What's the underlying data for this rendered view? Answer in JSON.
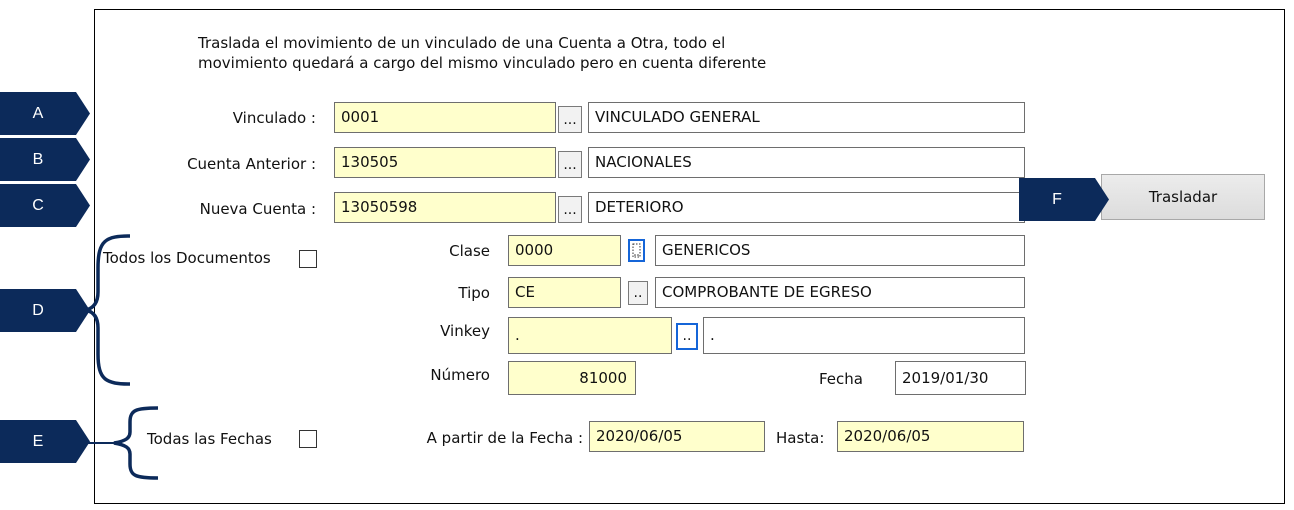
{
  "intro": {
    "text": "Traslada el movimiento de un vinculado de una Cuenta a Otra, todo el\nmovimiento quedará a cargo del mismo vinculado pero en cuenta diferente"
  },
  "vinculado": {
    "label": "Vinculado :",
    "code": "0001",
    "button": "...",
    "name": "VINCULADO GENERAL"
  },
  "cuenta_anterior": {
    "label": "Cuenta Anterior :",
    "code": "130505",
    "button": "...",
    "name": "NACIONALES"
  },
  "nueva_cuenta": {
    "label": "Nueva Cuenta :",
    "code": "13050598",
    "button": "...",
    "name": "DETERIORO"
  },
  "trasladar": {
    "label": "Trasladar"
  },
  "documentos": {
    "todos_label": "Todos los Documentos",
    "clase": {
      "label": "Clase",
      "code": "0000",
      "name": "GENERICOS"
    },
    "tipo": {
      "label": "Tipo",
      "code": "CE",
      "button": "..",
      "name": "COMPROBANTE DE EGRESO"
    },
    "vinkey": {
      "label": "Vinkey",
      "code": ".",
      "button": "..",
      "name": "."
    },
    "numero": {
      "label": "Número",
      "value": "81000"
    },
    "fecha": {
      "label": "Fecha",
      "value": "2019/01/30"
    }
  },
  "fechas": {
    "todas_label": "Todas las Fechas",
    "desde_label": "A partir de la Fecha :",
    "desde": "2020/06/05",
    "hasta_label": "Hasta:",
    "hasta": "2020/06/05"
  },
  "tags": {
    "a": "A",
    "b": "B",
    "c": "C",
    "d": "D",
    "e": "E",
    "f": "F"
  },
  "colors": {
    "tag": "#0c2a5a",
    "field_yellow": "#ffffcc",
    "focus_blue": "#1565d8"
  }
}
